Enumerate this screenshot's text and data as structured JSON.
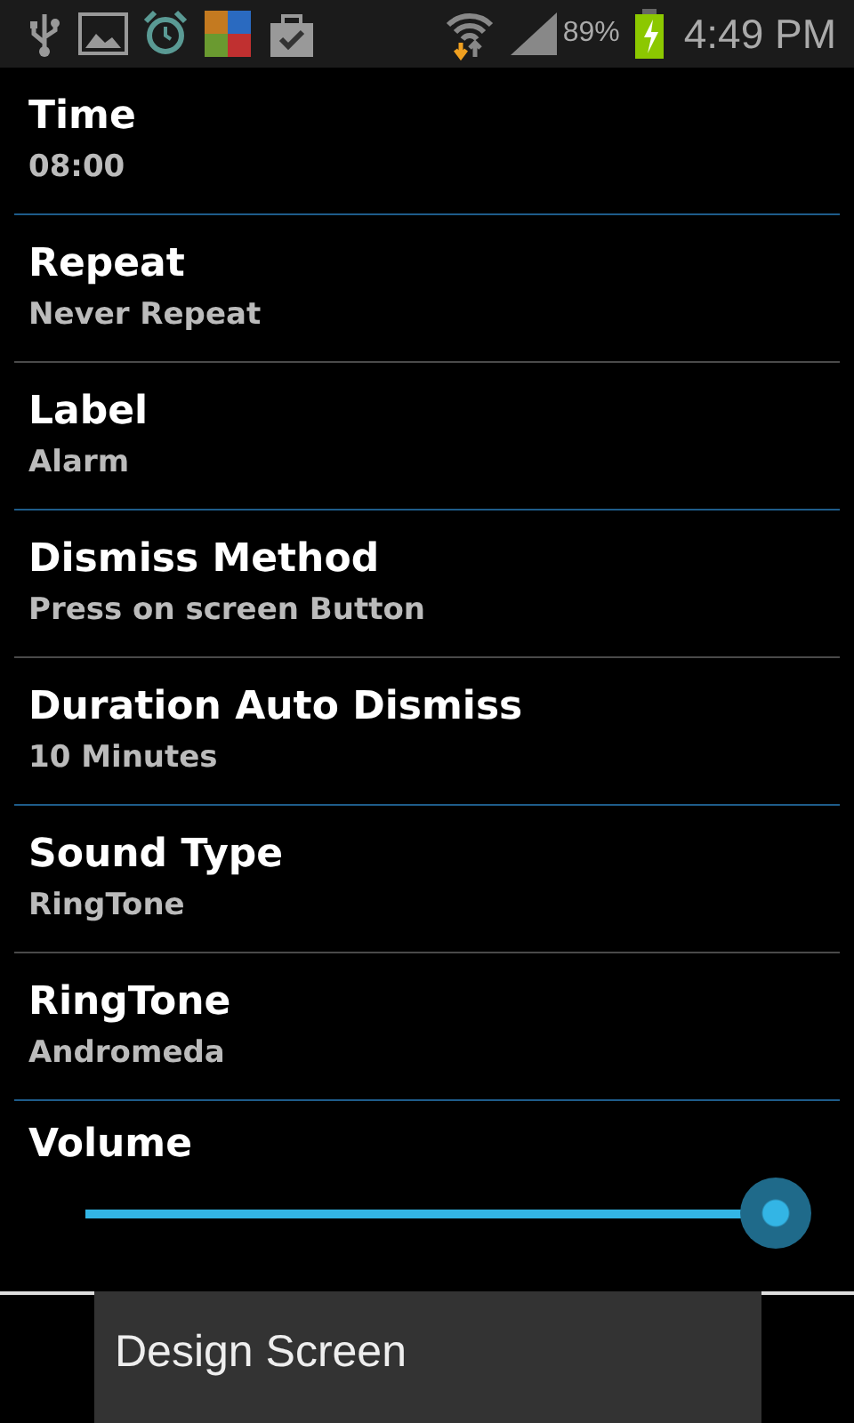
{
  "status_bar": {
    "battery": "89%",
    "time": "4:49 PM"
  },
  "settings": [
    {
      "title": "Time",
      "value": "08:00"
    },
    {
      "title": "Repeat",
      "value": "Never Repeat"
    },
    {
      "title": "Label",
      "value": "Alarm"
    },
    {
      "title": "Dismiss Method",
      "value": "Press on screen Button"
    },
    {
      "title": "Duration Auto Dismiss",
      "value": "10 Minutes"
    },
    {
      "title": "Sound Type",
      "value": "RingTone"
    },
    {
      "title": "RingTone",
      "value": "Andromeda"
    }
  ],
  "volume": {
    "title": "Volume",
    "level": 1
  },
  "toast": "Design Screen"
}
